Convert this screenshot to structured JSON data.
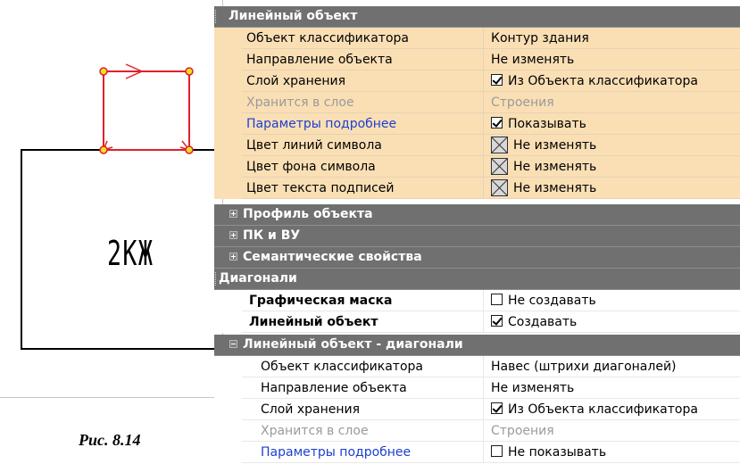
{
  "drawing": {
    "building_label": "2КЖ",
    "caption": "Рис. 8.14"
  },
  "grid": {
    "linear_object": {
      "title": "Линейный объект",
      "rows": [
        {
          "name": "Объект классификатора",
          "value": "Контур здания"
        },
        {
          "name": "Направление объекта",
          "value": "Не изменять"
        },
        {
          "name": "Слой хранения",
          "value": "Из Объекта классификатора",
          "checked": true
        },
        {
          "name": "Хранится в слое",
          "value": "Строения"
        },
        {
          "name": "Параметры подробнее",
          "value": "Показывать",
          "checked": true
        },
        {
          "name": "Цвет линий символа",
          "value": "Не изменять"
        },
        {
          "name": "Цвет фона символа",
          "value": "Не изменять"
        },
        {
          "name": "Цвет текста подписей",
          "value": "Не изменять"
        }
      ]
    },
    "collapsed_sections": [
      "Профиль объекта",
      "ПК и ВУ",
      "Семантические свойства"
    ],
    "diagonals": {
      "title": "Диагонали",
      "rows": [
        {
          "name": "Графическая маска",
          "value": "Не создавать",
          "checked": false
        },
        {
          "name": "Линейный объект",
          "value": "Создавать",
          "checked": true
        }
      ]
    },
    "diagonal_line": {
      "title": "Линейный объект - диагонали",
      "rows": [
        {
          "name": "Объект классификатора",
          "value": "Навес (штрихи диагоналей)"
        },
        {
          "name": "Направление объекта",
          "value": "Не изменять"
        },
        {
          "name": "Слой хранения",
          "value": "Из Объекта классификатора",
          "checked": true
        },
        {
          "name": "Хранится в слое",
          "value": "Строения"
        },
        {
          "name": "Параметры подробнее",
          "value": "Не показывать",
          "checked": false
        }
      ]
    }
  },
  "colors": {
    "header_bg": "#707070",
    "orange_row_bg": "#fadfb5",
    "link": "#1c3fd0",
    "object_outline": "#e0202a",
    "vertex": "#f0e020"
  },
  "icons": [
    "expand-plus-icon",
    "collapse-minus-icon",
    "checkbox-icon",
    "color-swatch-icon"
  ]
}
